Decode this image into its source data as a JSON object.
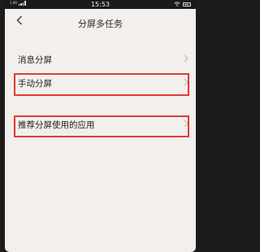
{
  "status_bar": {
    "signal_text": "1.00",
    "time": "15:53",
    "icons": [
      "signal-icon",
      "wifi-icon",
      "battery-icon"
    ]
  },
  "header": {
    "back_icon": "chevron-left-icon",
    "title": "分屏多任务"
  },
  "settings": {
    "items": [
      {
        "label": "消息分屏",
        "chevron_icon": "chevron-right-icon"
      },
      {
        "label": "手动分屏",
        "chevron_icon": "chevron-right-icon"
      },
      {
        "label": "推荐分屏使用的应用",
        "chevron_icon": "chevron-right-icon"
      }
    ]
  },
  "colors": {
    "highlight": "#e23a35",
    "background": "#f2efed"
  }
}
